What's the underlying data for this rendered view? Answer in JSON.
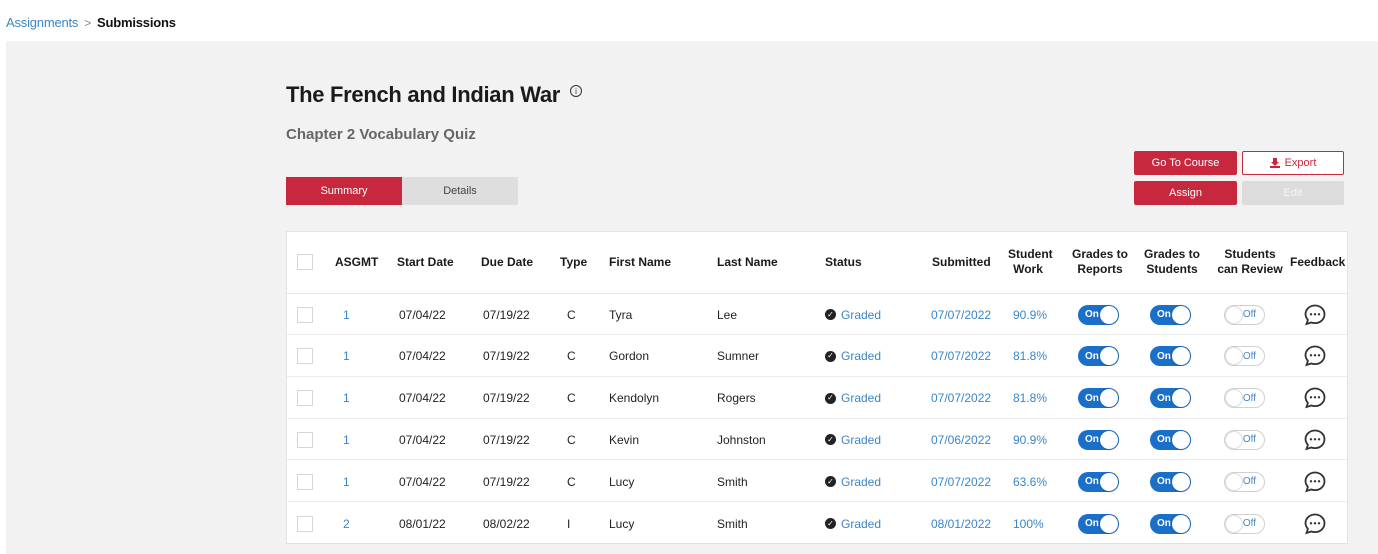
{
  "breadcrumb": {
    "parent": "Assignments",
    "separator": ">",
    "current": "Submissions"
  },
  "page": {
    "title": "The French and Indian War",
    "info_icon": "info-icon",
    "subtitle": "Chapter 2 Vocabulary Quiz"
  },
  "tabs": [
    {
      "label": "Summary",
      "active": true
    },
    {
      "label": "Details",
      "active": false
    }
  ],
  "actions": {
    "go_to_course": "Go To Course",
    "export": "Export",
    "assign": "Assign",
    "edit": "Edit"
  },
  "colors": {
    "accent": "#c8283e",
    "link": "#3a86c8",
    "toggle_on": "#1a6fc9"
  },
  "table": {
    "headers": {
      "asgmt": "ASGMT",
      "start_date": "Start Date",
      "due_date": "Due Date",
      "type": "Type",
      "first_name": "First Name",
      "last_name": "Last Name",
      "status": "Status",
      "submitted": "Submitted",
      "student_work_1": "Student",
      "student_work_2": "Work",
      "grades_reports_1": "Grades to",
      "grades_reports_2": "Reports",
      "grades_students_1": "Grades to",
      "grades_students_2": "Students",
      "students_review_1": "Students",
      "students_review_2": "can Review",
      "feedback": "Feedback"
    },
    "toggle_labels": {
      "on": "On",
      "off": "Off"
    },
    "rows": [
      {
        "asgmt": "1",
        "start": "07/04/22",
        "due": "07/19/22",
        "type": "C",
        "first": "Tyra",
        "last": "Lee",
        "status": "Graded",
        "submitted": "07/07/2022",
        "work": "90.9%",
        "reports": true,
        "students": true,
        "review": false
      },
      {
        "asgmt": "1",
        "start": "07/04/22",
        "due": "07/19/22",
        "type": "C",
        "first": "Gordon",
        "last": "Sumner",
        "status": "Graded",
        "submitted": "07/07/2022",
        "work": "81.8%",
        "reports": true,
        "students": true,
        "review": false
      },
      {
        "asgmt": "1",
        "start": "07/04/22",
        "due": "07/19/22",
        "type": "C",
        "first": "Kendolyn",
        "last": "Rogers",
        "status": "Graded",
        "submitted": "07/07/2022",
        "work": "81.8%",
        "reports": true,
        "students": true,
        "review": false
      },
      {
        "asgmt": "1",
        "start": "07/04/22",
        "due": "07/19/22",
        "type": "C",
        "first": "Kevin",
        "last": "Johnston",
        "status": "Graded",
        "submitted": "07/06/2022",
        "work": "90.9%",
        "reports": true,
        "students": true,
        "review": false
      },
      {
        "asgmt": "1",
        "start": "07/04/22",
        "due": "07/19/22",
        "type": "C",
        "first": "Lucy",
        "last": "Smith",
        "status": "Graded",
        "submitted": "07/07/2022",
        "work": "63.6%",
        "reports": true,
        "students": true,
        "review": false
      },
      {
        "asgmt": "2",
        "start": "08/01/22",
        "due": "08/02/22",
        "type": "I",
        "first": "Lucy",
        "last": "Smith",
        "status": "Graded",
        "submitted": "08/01/2022",
        "work": "100%",
        "reports": true,
        "students": true,
        "review": false
      }
    ]
  }
}
